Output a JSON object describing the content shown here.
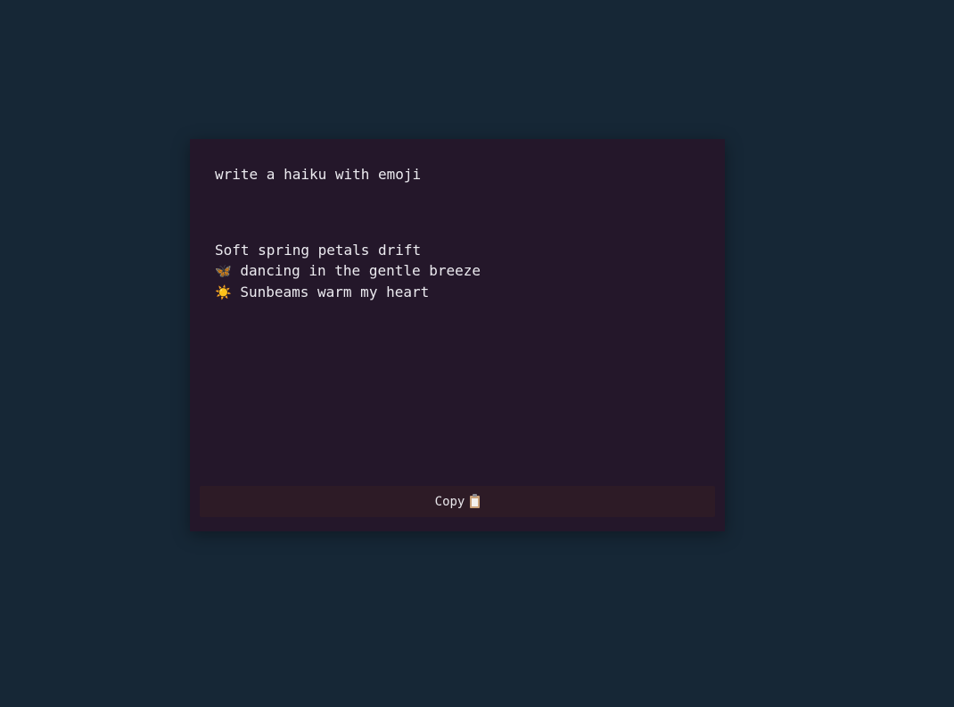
{
  "prompt": {
    "text": "write a haiku with emoji"
  },
  "response": {
    "lines": [
      {
        "emoji": "",
        "text": "Soft spring petals drift"
      },
      {
        "emoji": "🦋",
        "text": " dancing in the gentle breeze"
      },
      {
        "emoji": "☀️",
        "text": " Sunbeams warm my heart"
      }
    ]
  },
  "actions": {
    "copy_label": "Copy",
    "copy_icon": "clipboard-icon"
  },
  "colors": {
    "background": "#162736",
    "card": "#24172a",
    "button": "#2d1b26",
    "text": "#ecebf0"
  }
}
